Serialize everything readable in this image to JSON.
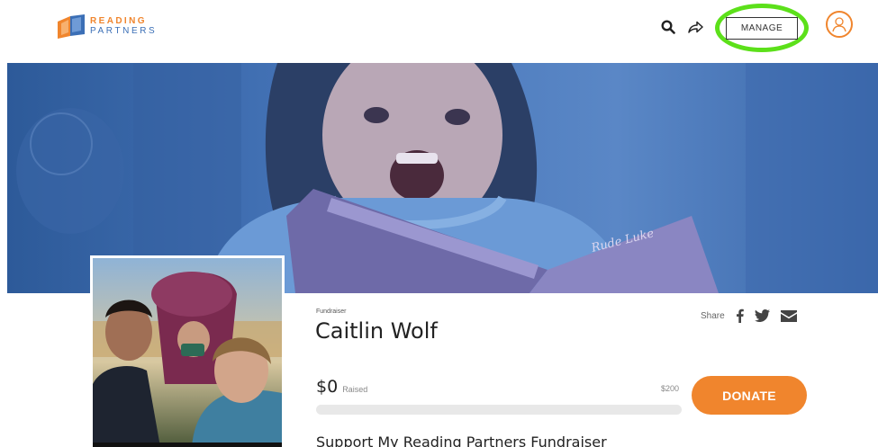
{
  "header": {
    "logo": {
      "line1": "READING",
      "line2": "PARTNERS",
      "icon": "book-logo-icon"
    },
    "icons": {
      "search": "search-icon",
      "share": "share-arrow-icon",
      "avatar": "user-avatar-icon"
    },
    "manage_label": "MANAGE"
  },
  "hero": {
    "image": "child-reading-book-photo",
    "book_text": "Rude Luke"
  },
  "profile": {
    "photo": "family-selfie-photo"
  },
  "fundraiser": {
    "label": "Fundraiser",
    "name": "Caitlin Wolf",
    "share_label": "Share",
    "share_icons": [
      "facebook-icon",
      "twitter-icon",
      "email-icon"
    ],
    "raised_amount": "$0",
    "raised_label": "Raised",
    "goal": "$200",
    "progress_fraction": 0,
    "donate_label": "DONATE",
    "story_title": "Support My Reading Partners Fundraiser"
  },
  "colors": {
    "accent": "#f0852d",
    "brand_blue": "#3b6fb6",
    "highlight_ring": "#5ce01a"
  }
}
